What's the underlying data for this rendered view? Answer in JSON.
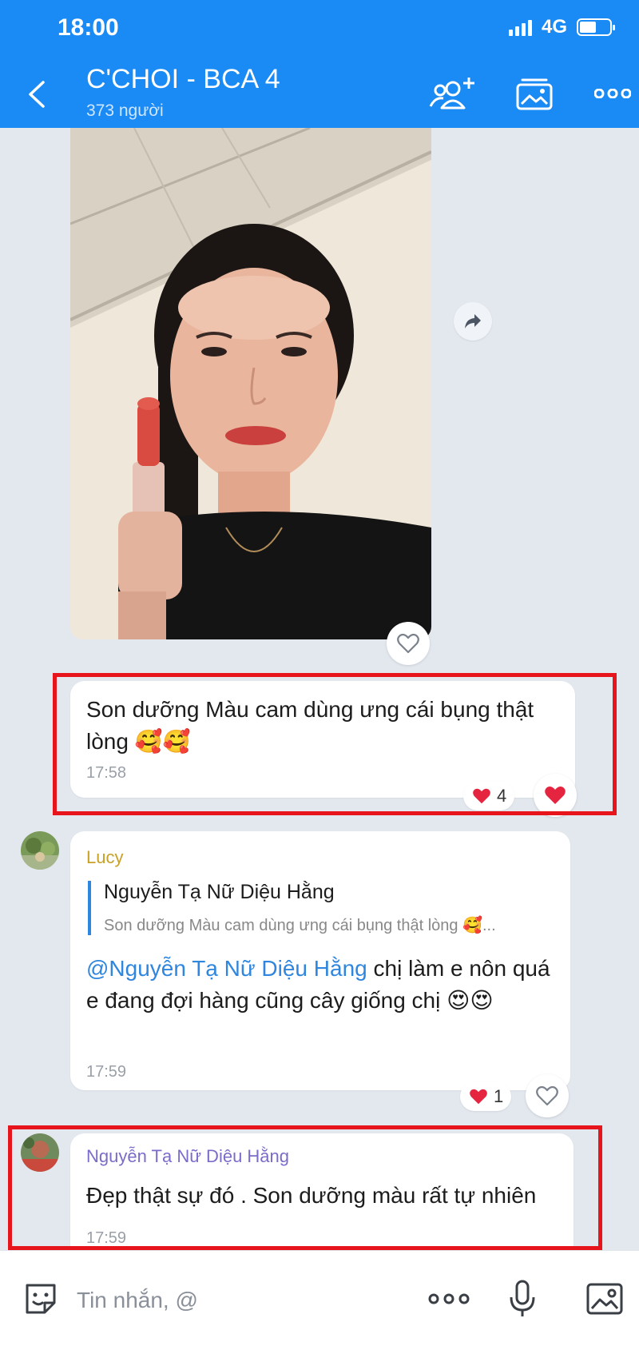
{
  "status_bar": {
    "time": "18:00",
    "network": "4G"
  },
  "header": {
    "title": "C'CHOI - BCA 4",
    "subtitle": "373 người",
    "icons": [
      "back-icon",
      "add-member-icon",
      "media-gallery-icon",
      "more-icon"
    ]
  },
  "messages": [
    {
      "id": "m1",
      "text": "Son dưỡng Màu cam dùng ưng cái bụng thật lòng 🥰🥰",
      "time": "17:58",
      "reaction_count": "4",
      "highlighted": true
    },
    {
      "id": "m2",
      "sender": "Lucy",
      "quote_name": "Nguyễn Tạ Nữ Diệu Hằng",
      "quote_text": "Son dưỡng Màu cam dùng ưng cái bụng thật lòng 🥰...",
      "mention": "@Nguyễn Tạ Nữ Diệu Hằng",
      "text": " chị làm e nôn quá e đang đợi hàng cũng cây giống chị 😍😍",
      "time": "17:59",
      "reaction_count": "1"
    },
    {
      "id": "m3",
      "sender": "Nguyễn Tạ Nữ Diệu Hằng",
      "text": "Đẹp thật sự đó . Son dưỡng màu rất tự nhiên",
      "time": "17:59",
      "highlighted": true
    }
  ],
  "input": {
    "placeholder": "Tin nhắn, @"
  },
  "colors": {
    "header": "#1a8af5",
    "background": "#e3e8ef",
    "highlight": "#e8141c",
    "mention": "#2f86de",
    "lucy_name": "#c8a227",
    "sender_name": "#7a6cc9",
    "heart": "#e5243f"
  }
}
